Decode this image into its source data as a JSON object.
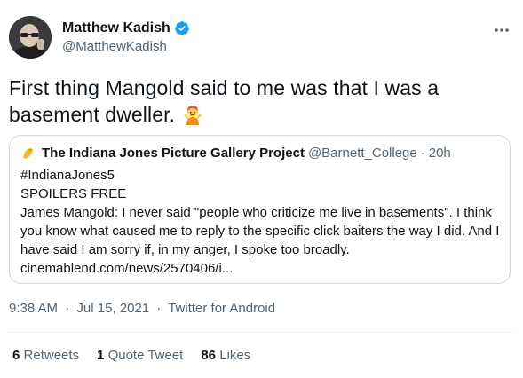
{
  "author": {
    "display_name": "Matthew Kadish",
    "handle": "@MatthewKadish",
    "verified": true,
    "verified_color": "#1d9bf0"
  },
  "tweet": {
    "text": "First thing Mangold said to me was that I was a basement dweller.",
    "emoji": "person-shrugging-emoji"
  },
  "quote": {
    "name": "The Indiana Jones Picture Gallery Project",
    "handle": "@Barnett_College",
    "separator": "·",
    "age": "20h",
    "lines": [
      "#IndianaJones5",
      "SPOILERS FREE",
      "James Mangold: I never said \"people who criticize me live in basements\". I think you know what caused me to reply to the specific click baiters the way I did. And I have said I am sorry if, in my anger, I spoke too broadly.",
      "cinemablend.com/news/2570406/i..."
    ]
  },
  "meta": {
    "time": "9:38 AM",
    "separator": "·",
    "date": "Jul 15, 2021",
    "source": "Twitter for Android"
  },
  "stats": {
    "retweets_count": "6",
    "retweets_label": "Retweets",
    "quotes_count": "1",
    "quotes_label": "Quote Tweet",
    "likes_count": "86",
    "likes_label": "Likes"
  },
  "colors": {
    "text": "#0f1419",
    "secondary": "#536471",
    "border": "#cfd9de",
    "accent": "#1d9bf0"
  }
}
